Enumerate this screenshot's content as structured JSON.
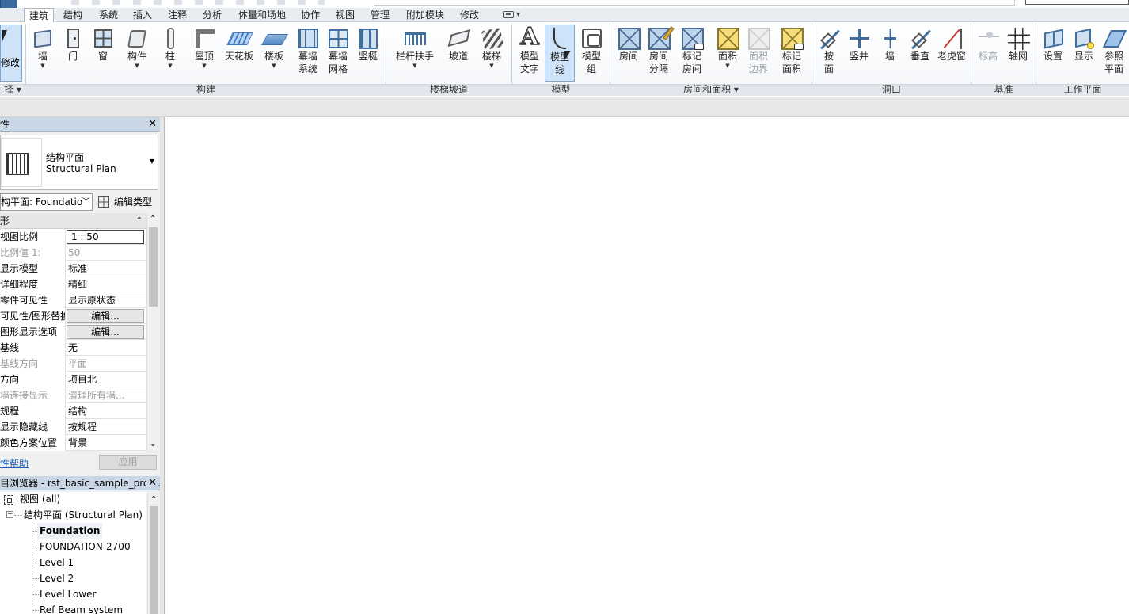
{
  "tabs": [
    "建筑",
    "结构",
    "系统",
    "插入",
    "注释",
    "分析",
    "体量和场地",
    "协作",
    "视图",
    "管理",
    "附加模块",
    "修改"
  ],
  "active_tab": "建筑",
  "ribbon": {
    "modify": "修改",
    "select_panel": "择",
    "build": {
      "label": "构建",
      "buttons": [
        "墙",
        "门",
        "窗",
        "构件",
        "柱",
        "屋顶",
        "天花板",
        "楼板",
        "幕墙\n系统",
        "幕墙\n网格",
        "竖梃"
      ]
    },
    "circulation": {
      "label": "楼梯坡道",
      "buttons": [
        "栏杆扶手",
        "坡道",
        "楼梯"
      ]
    },
    "model": {
      "label": "模型",
      "buttons": [
        "模型\n文字",
        "模型\n线",
        "模型\n组"
      ]
    },
    "room_area": {
      "label": "房间和面积",
      "buttons": [
        "房间",
        "房间\n分隔",
        "标记\n房间",
        "面积",
        "面积\n边界",
        "标记\n面积"
      ]
    },
    "opening": {
      "label": "洞口",
      "buttons": [
        "按\n面",
        "竖井",
        "墙",
        "垂直",
        "老虎窗"
      ]
    },
    "datum": {
      "label": "基准",
      "buttons": [
        "标高",
        "轴网"
      ]
    },
    "workplane": {
      "label": "工作平面",
      "buttons": [
        "设置",
        "显示",
        "参照\n平面"
      ]
    }
  },
  "properties": {
    "title": "性",
    "type_line1": "结构平面",
    "type_line2": "Structural Plan",
    "instance_select": "构平面: Foundatio",
    "edit_type": "编辑类型",
    "section": "形",
    "rows": [
      {
        "k": "视图比例",
        "v": "1 : 50",
        "kind": "input"
      },
      {
        "k": "比例值 1:",
        "v": "50",
        "kind": "dim"
      },
      {
        "k": "显示模型",
        "v": "标准",
        "kind": "text"
      },
      {
        "k": "详细程度",
        "v": "精细",
        "kind": "text"
      },
      {
        "k": "零件可见性",
        "v": "显示原状态",
        "kind": "text"
      },
      {
        "k": "可见性/图形替换",
        "v": "编辑...",
        "kind": "btn"
      },
      {
        "k": "图形显示选项",
        "v": "编辑...",
        "kind": "btn"
      },
      {
        "k": "基线",
        "v": "无",
        "kind": "text"
      },
      {
        "k": "基线方向",
        "v": "平面",
        "kind": "dim"
      },
      {
        "k": "方向",
        "v": "项目北",
        "kind": "text"
      },
      {
        "k": "墙连接显示",
        "v": "清理所有墙...",
        "kind": "dim"
      },
      {
        "k": "规程",
        "v": "结构",
        "kind": "text"
      },
      {
        "k": "显示隐藏线",
        "v": "按规程",
        "kind": "text"
      },
      {
        "k": "颜色方案位置",
        "v": "背景",
        "kind": "text"
      }
    ],
    "help": "性帮助",
    "apply": "应用"
  },
  "browser": {
    "title": "目浏览器 - rst_basic_sample_proj...",
    "root": "视图 (all)",
    "group": "结构平面 (Structural Plan)",
    "items": [
      "Foundation",
      "FOUNDATION-2700",
      "Level 1",
      "Level 2",
      "Level Lower",
      "Ref Beam system"
    ],
    "selected": "Foundation"
  }
}
